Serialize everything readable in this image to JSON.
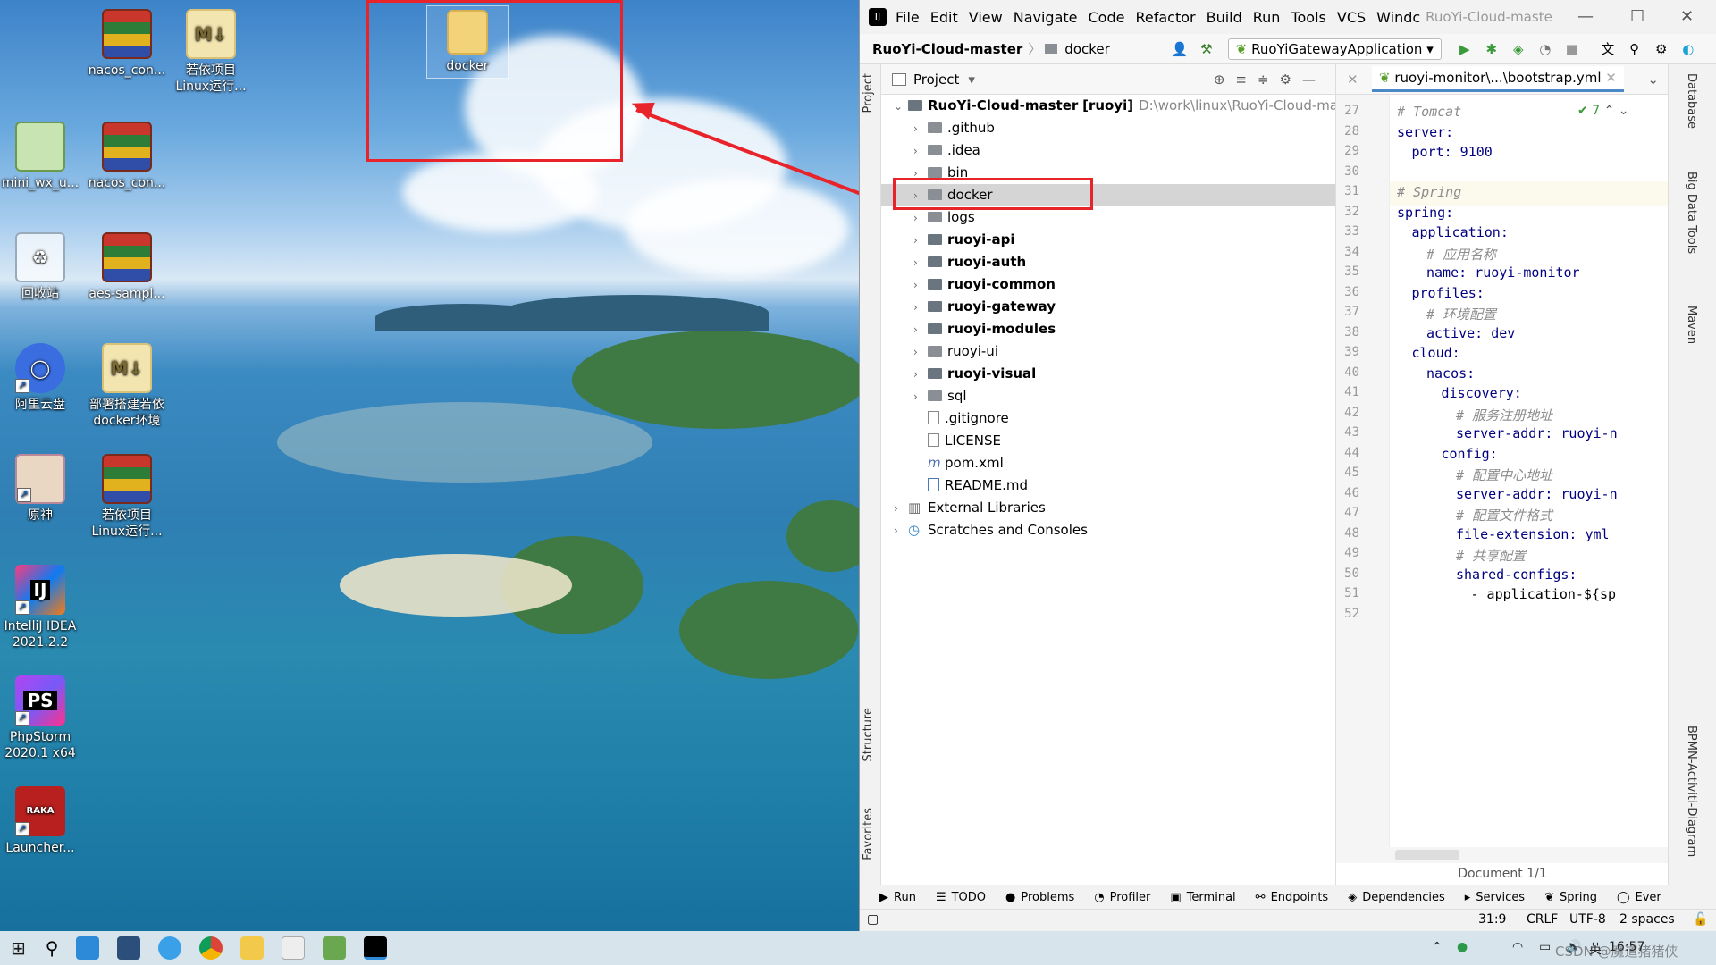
{
  "desktop": {
    "icons": [
      {
        "label": "nacos_con...",
        "type": "winrar"
      },
      {
        "label": "若依项目\nLinux运行...",
        "type": "md"
      },
      {
        "label": "mini_wx_u...",
        "type": "app"
      },
      {
        "label": "nacos_con...",
        "type": "winrar"
      },
      {
        "label": "回收站",
        "type": "recycle"
      },
      {
        "label": "aes-sampl...",
        "type": "winrar"
      },
      {
        "label": "阿里云盘",
        "type": "aliyun"
      },
      {
        "label": "部署搭建若依\ndocker环境",
        "type": "md"
      },
      {
        "label": "原神",
        "type": "game"
      },
      {
        "label": "若依项目\nLinux运行...",
        "type": "winrar"
      },
      {
        "label": "IntelliJ IDEA\n2021.2.2",
        "type": "idea"
      },
      {
        "label": "PhpStorm\n2020.1 x64",
        "type": "phpstorm"
      },
      {
        "label": "Launcher...",
        "type": "launcher"
      }
    ],
    "docker_folder_label": "docker"
  },
  "ide": {
    "menu": [
      "File",
      "Edit",
      "View",
      "Navigate",
      "Code",
      "Refactor",
      "Build",
      "Run",
      "Tools",
      "VCS",
      "Windc"
    ],
    "window_title": "RuoYi-Cloud-maste",
    "breadcrumb": {
      "project": "RuoYi-Cloud-master",
      "folder": "docker"
    },
    "run_config": "RuoYiGatewayApplication",
    "project_panel_title": "Project",
    "tree": {
      "root_label": "RuoYi-Cloud-master",
      "root_module": "[ruoyi]",
      "root_path": "D:\\work\\linux\\RuoYi-Cloud-master",
      "items": [
        {
          "label": ".github",
          "bold": false,
          "kind": "folder"
        },
        {
          "label": ".idea",
          "bold": false,
          "kind": "folder"
        },
        {
          "label": "bin",
          "bold": false,
          "kind": "folder"
        },
        {
          "label": "docker",
          "bold": false,
          "kind": "folder",
          "selected": true
        },
        {
          "label": "logs",
          "bold": false,
          "kind": "folder"
        },
        {
          "label": "ruoyi-api",
          "bold": true,
          "kind": "module"
        },
        {
          "label": "ruoyi-auth",
          "bold": true,
          "kind": "module"
        },
        {
          "label": "ruoyi-common",
          "bold": true,
          "kind": "module"
        },
        {
          "label": "ruoyi-gateway",
          "bold": true,
          "kind": "module"
        },
        {
          "label": "ruoyi-modules",
          "bold": true,
          "kind": "module"
        },
        {
          "label": "ruoyi-ui",
          "bold": false,
          "kind": "folder"
        },
        {
          "label": "ruoyi-visual",
          "bold": true,
          "kind": "module"
        },
        {
          "label": "sql",
          "bold": false,
          "kind": "folder"
        },
        {
          "label": ".gitignore",
          "bold": false,
          "kind": "file"
        },
        {
          "label": "LICENSE",
          "bold": false,
          "kind": "file"
        },
        {
          "label": "pom.xml",
          "bold": false,
          "kind": "maven"
        },
        {
          "label": "README.md",
          "bold": false,
          "kind": "md"
        }
      ],
      "external_libraries": "External Libraries",
      "scratches": "Scratches and Consoles"
    },
    "editor": {
      "tab": "ruoyi-monitor\\...\\bootstrap.yml",
      "inspection_count": "7",
      "lines": [
        {
          "n": "27",
          "text": "# Tomcat",
          "cls": "cm",
          "indent": 0
        },
        {
          "n": "28",
          "text": "server:",
          "cls": "k",
          "indent": 0
        },
        {
          "n": "29",
          "text": "port: 9100",
          "cls": "k",
          "indent": 1
        },
        {
          "n": "30",
          "text": "",
          "cls": "v",
          "indent": 0
        },
        {
          "n": "31",
          "text": "# Spring",
          "cls": "cm",
          "indent": 0
        },
        {
          "n": "32",
          "text": "spring:",
          "cls": "k",
          "indent": 0
        },
        {
          "n": "33",
          "text": "application:",
          "cls": "k",
          "indent": 1
        },
        {
          "n": "34",
          "text": "# 应用名称",
          "cls": "cm",
          "indent": 2
        },
        {
          "n": "35",
          "text": "name: ruoyi-monitor",
          "cls": "k",
          "indent": 2
        },
        {
          "n": "36",
          "text": "profiles:",
          "cls": "k",
          "indent": 1
        },
        {
          "n": "37",
          "text": "# 环境配置",
          "cls": "cm",
          "indent": 2
        },
        {
          "n": "38",
          "text": "active: dev",
          "cls": "k",
          "indent": 2
        },
        {
          "n": "39",
          "text": "cloud:",
          "cls": "k",
          "indent": 1
        },
        {
          "n": "40",
          "text": "nacos:",
          "cls": "k",
          "indent": 2
        },
        {
          "n": "41",
          "text": "discovery:",
          "cls": "k",
          "indent": 3
        },
        {
          "n": "42",
          "text": "# 服务注册地址",
          "cls": "cm",
          "indent": 4
        },
        {
          "n": "43",
          "text": "server-addr: ruoyi-n",
          "cls": "k",
          "indent": 4
        },
        {
          "n": "44",
          "text": "config:",
          "cls": "k",
          "indent": 3
        },
        {
          "n": "45",
          "text": "# 配置中心地址",
          "cls": "cm",
          "indent": 4
        },
        {
          "n": "46",
          "text": "server-addr: ruoyi-n",
          "cls": "k",
          "indent": 4
        },
        {
          "n": "47",
          "text": "# 配置文件格式",
          "cls": "cm",
          "indent": 4
        },
        {
          "n": "48",
          "text": "file-extension: yml",
          "cls": "k",
          "indent": 4
        },
        {
          "n": "49",
          "text": "# 共享配置",
          "cls": "cm",
          "indent": 4
        },
        {
          "n": "50",
          "text": "shared-configs:",
          "cls": "k",
          "indent": 4
        },
        {
          "n": "51",
          "text": "- application-${sp",
          "cls": "v",
          "indent": 5
        },
        {
          "n": "52",
          "text": "",
          "cls": "v",
          "indent": 0
        }
      ],
      "footer": "Document 1/1"
    },
    "left_tabs": [
      "Project",
      "Structure",
      "Favorites"
    ],
    "right_tabs": [
      "Database",
      "Big Data Tools",
      "Maven",
      "BPMN-Activiti-Diagram"
    ],
    "bottom_tools": [
      "Run",
      "TODO",
      "Problems",
      "Profiler",
      "Terminal",
      "Endpoints",
      "Dependencies",
      "Services",
      "Spring",
      "Ever"
    ],
    "status": {
      "pos": "31:9",
      "eol": "CRLF",
      "enc": "UTF-8",
      "indent": "2 spaces"
    }
  },
  "taskbar": {
    "tray_lang": "英",
    "time": "16:57",
    "watermark": "CSDN @魔道猪猪侠"
  }
}
